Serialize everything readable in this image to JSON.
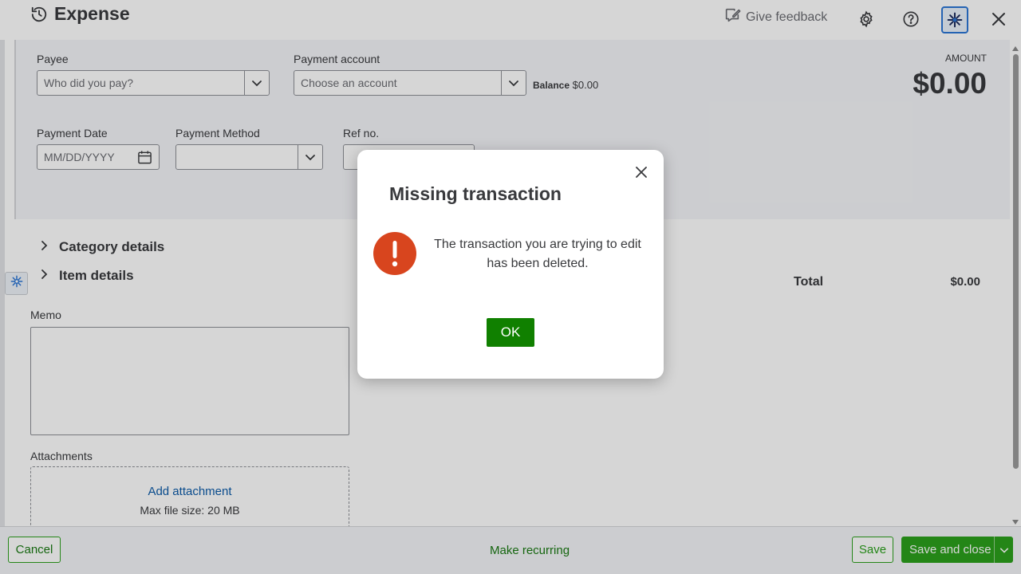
{
  "header": {
    "title": "Expense",
    "feedback_label": "Give feedback"
  },
  "form": {
    "payee": {
      "label": "Payee",
      "placeholder": "Who did you pay?"
    },
    "payment_account": {
      "label": "Payment account",
      "placeholder": "Choose an account"
    },
    "balance": {
      "label": "Balance",
      "value": "$0.00"
    },
    "amount": {
      "label": "AMOUNT",
      "value": "$0.00"
    },
    "payment_date": {
      "label": "Payment Date",
      "placeholder": "MM/DD/YYYY"
    },
    "payment_method": {
      "label": "Payment Method",
      "value": ""
    },
    "ref_no": {
      "label": "Ref no.",
      "value": ""
    }
  },
  "sections": {
    "category_details": "Category details",
    "item_details": "Item details"
  },
  "totals": {
    "label": "Total",
    "value": "$0.00"
  },
  "memo": {
    "label": "Memo",
    "value": ""
  },
  "attachments": {
    "label": "Attachments",
    "add_label": "Add attachment",
    "max_size": "Max file size: 20 MB"
  },
  "footer": {
    "cancel": "Cancel",
    "make_recurring": "Make recurring",
    "save": "Save",
    "save_and_close": "Save and close"
  },
  "modal": {
    "title": "Missing transaction",
    "message": "The transaction you are trying to edit has been deleted.",
    "ok": "OK"
  },
  "colors": {
    "brand_green": "#2ca01c",
    "ok_green": "#108000",
    "warning_red": "#d8451e",
    "link_blue": "#0d5ba8",
    "ai_blue": "#2c76d6"
  },
  "icons": {
    "history": "history-icon",
    "feedback": "feedback-icon",
    "settings": "gear-icon",
    "help": "help-icon",
    "assistant": "sparkle-icon",
    "close": "close-icon",
    "calendar": "calendar-icon",
    "warning": "exclamation-icon"
  }
}
